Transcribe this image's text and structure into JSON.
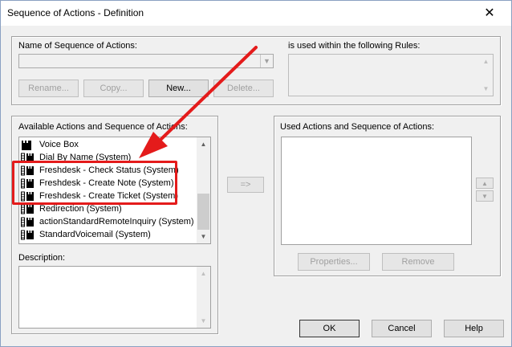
{
  "window": {
    "title": "Sequence of Actions - Definition",
    "close_label": "✕"
  },
  "definition": {
    "name_label": "Name of Sequence of Actions:",
    "name_value": "",
    "rename_label": "Rename...",
    "copy_label": "Copy...",
    "new_label": "New...",
    "delete_label": "Delete...",
    "used_within_label": "is used within the following Rules:"
  },
  "available": {
    "label": "Available Actions and Sequence of Actions:",
    "items": [
      {
        "label": "Voice Box",
        "icon": "voice-box-icon"
      },
      {
        "label": "Dial By Name (System)",
        "icon": "sequence-icon"
      },
      {
        "label": "Freshdesk - Check Status (System)",
        "icon": "sequence-icon"
      },
      {
        "label": "Freshdesk - Create Note (System)",
        "icon": "sequence-icon"
      },
      {
        "label": "Freshdesk - Create Ticket (System)",
        "icon": "sequence-icon"
      },
      {
        "label": "Redirection (System)",
        "icon": "sequence-icon"
      },
      {
        "label": "actionStandardRemoteInquiry (System)",
        "icon": "sequence-icon"
      },
      {
        "label": "StandardVoicemail (System)",
        "icon": "sequence-icon"
      }
    ],
    "description_label": "Description:"
  },
  "transfer": {
    "add_label": "=>"
  },
  "used": {
    "label": "Used Actions and Sequence of Actions:",
    "properties_label": "Properties...",
    "remove_label": "Remove"
  },
  "footer": {
    "ok_label": "OK",
    "cancel_label": "Cancel",
    "help_label": "Help"
  },
  "colors": {
    "annotation_red": "#e41b1b",
    "dialog_bg": "#f0f0f0"
  }
}
